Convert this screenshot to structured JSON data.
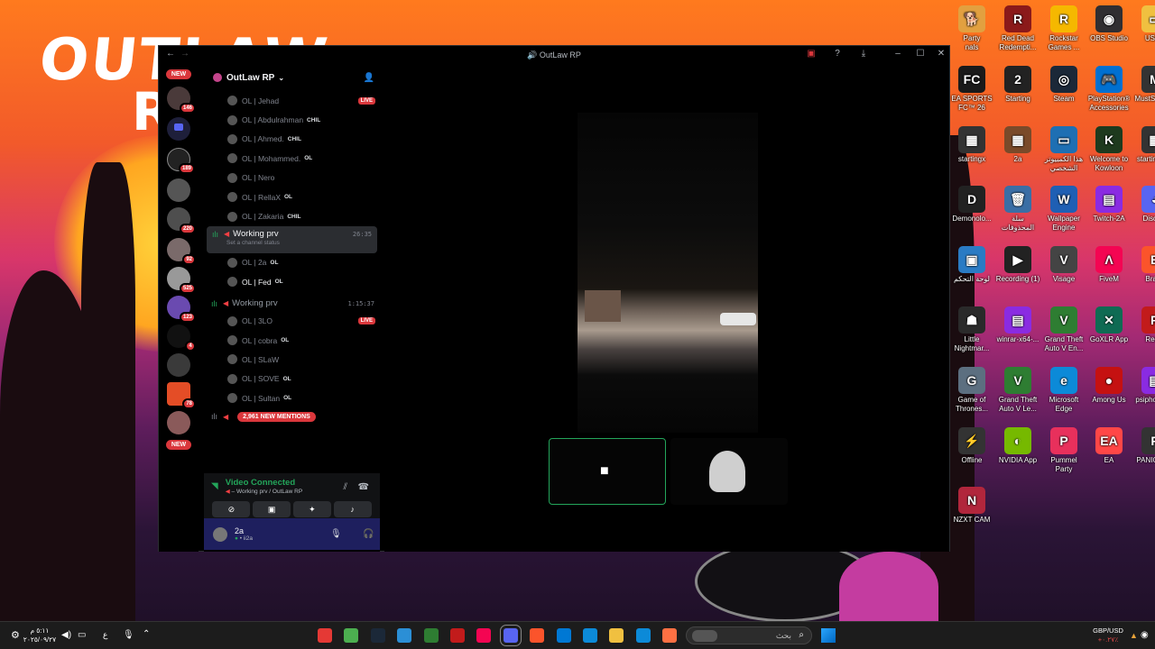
{
  "window": {
    "title": "OutLaw RP"
  },
  "servers": {
    "new_top": "NEW",
    "new_bottom": "NEW",
    "badges": [
      "146",
      "189",
      "220",
      "92",
      "525",
      "123",
      "4",
      "78"
    ]
  },
  "guild": {
    "name": "OutLaw RP"
  },
  "members_top": [
    {
      "name": "OL | Jehad",
      "tag": "",
      "live": "LIVE"
    },
    {
      "name": "OL | Abdulrahman",
      "tag": "CHIL",
      "live": ""
    },
    {
      "name": "OL | Ahmed.",
      "tag": "CHIL",
      "live": ""
    },
    {
      "name": "OL | Mohammed.",
      "tag": "OL",
      "live": ""
    },
    {
      "name": "OL | Nero",
      "tag": "",
      "live": ""
    },
    {
      "name": "OL | RellaX",
      "tag": "OL",
      "live": ""
    },
    {
      "name": "OL | Zakaria",
      "tag": "CHIL",
      "live": ""
    }
  ],
  "channel_active": {
    "name": "Working prv",
    "time": "26:35",
    "status_placeholder": "Set a channel status",
    "members": [
      {
        "name": "OL | 2a",
        "tag": "OL"
      },
      {
        "name": "OL | Fed",
        "tag": "OL"
      }
    ]
  },
  "channel_second": {
    "name": "Working prv",
    "time": "1:15:37",
    "members": [
      {
        "name": "OL | 3LO",
        "tag": "",
        "live": "LIVE"
      },
      {
        "name": "OL | cobra",
        "tag": "OL",
        "live": ""
      },
      {
        "name": "OL | SLaW",
        "tag": "",
        "live": ""
      },
      {
        "name": "OL | SOVE",
        "tag": "OL",
        "live": ""
      },
      {
        "name": "OL | Sultan",
        "tag": "OL",
        "live": ""
      }
    ]
  },
  "mentions_pill": "2,961 NEW MENTIONS",
  "voice": {
    "status": "Video Connected",
    "location": "Working prv / OutLaw RP"
  },
  "user": {
    "name": "2a",
    "sub": "ii2a"
  },
  "desktop_icons": [
    {
      "label": "Party\nnals",
      "color": "#e2a040",
      "glyph": "🐕"
    },
    {
      "label": "Red Dead\nRedempti...",
      "color": "#8b1a1a",
      "glyph": "R"
    },
    {
      "label": "Rockstar\nGames ...",
      "color": "#f5b800",
      "glyph": "R"
    },
    {
      "label": "OBS Studio",
      "color": "#302e31",
      "glyph": "◉"
    },
    {
      "label": "USER",
      "color": "#f0c040",
      "glyph": "▭"
    },
    {
      "label": "EA SPORTS\nFC™ 26",
      "color": "#1a1a1a",
      "glyph": "FC"
    },
    {
      "label": "Starting",
      "color": "#222",
      "glyph": "2"
    },
    {
      "label": "Steam",
      "color": "#1b2838",
      "glyph": "◎"
    },
    {
      "label": "PlayStation®\nAccessories",
      "color": "#0070d1",
      "glyph": "🎮"
    },
    {
      "label": "MustScream",
      "color": "#333",
      "glyph": "M"
    },
    {
      "label": "startingx",
      "color": "#333",
      "glyph": "▦"
    },
    {
      "label": "2a",
      "color": "#7a4a2a",
      "glyph": "▦"
    },
    {
      "label": "هذا الكمبيوتر\nالشخصي",
      "color": "#1e6fb3",
      "glyph": "▭"
    },
    {
      "label": "Welcome to\nKowloon",
      "color": "#1e3a1e",
      "glyph": "K"
    },
    {
      "label": "startingxس",
      "color": "#333",
      "glyph": "▦"
    },
    {
      "label": "Demonolo...",
      "color": "#222",
      "glyph": "D"
    },
    {
      "label": "سلة\nالمحذوفات",
      "color": "#3a6ea5",
      "glyph": "🗑"
    },
    {
      "label": "Wallpaper\nEngine",
      "color": "#1f5fb4",
      "glyph": "W"
    },
    {
      "label": "Twitch-2A",
      "color": "#8a2be2",
      "glyph": "▤"
    },
    {
      "label": "Discord",
      "color": "#5865f2",
      "glyph": "◕"
    },
    {
      "label": "لوحة التحكم",
      "color": "#2a7bc4",
      "glyph": "▣"
    },
    {
      "label": "Recording (1)",
      "color": "#222",
      "glyph": "▶"
    },
    {
      "label": "Visage",
      "color": "#444",
      "glyph": "V"
    },
    {
      "label": "FiveM",
      "color": "#f40552",
      "glyph": "Λ"
    },
    {
      "label": "Brave",
      "color": "#fb542b",
      "glyph": "B"
    },
    {
      "label": "Little\nNightmar...",
      "color": "#2a2a2a",
      "glyph": "☗"
    },
    {
      "label": "winrar-x64-...",
      "color": "#8a2be2",
      "glyph": "▤"
    },
    {
      "label": "Grand Theft\nAuto V En...",
      "color": "#2e7d32",
      "glyph": "V"
    },
    {
      "label": "GoXLR App",
      "color": "#0f6b53",
      "glyph": "✕"
    },
    {
      "label": "RedM",
      "color": "#c21b1b",
      "glyph": "R"
    },
    {
      "label": "Game of\nThrones...",
      "color": "#5c6f80",
      "glyph": "G"
    },
    {
      "label": "Grand Theft\nAuto V Le...",
      "color": "#2e7d32",
      "glyph": "V"
    },
    {
      "label": "Microsoft\nEdge",
      "color": "#0c8ad8",
      "glyph": "e"
    },
    {
      "label": "Among Us",
      "color": "#c51111",
      "glyph": "●"
    },
    {
      "label": "psiphon.v12",
      "color": "#8a2be2",
      "glyph": "▤"
    },
    {
      "label": "Offline",
      "color": "#333",
      "glyph": "⚡"
    },
    {
      "label": "NVIDIA App",
      "color": "#76b900",
      "glyph": "◐"
    },
    {
      "label": "Pummel\nParty",
      "color": "#e8305c",
      "glyph": "P"
    },
    {
      "label": "EA",
      "color": "#ff4747",
      "glyph": "EA"
    },
    {
      "label": "PANICORE",
      "color": "#333",
      "glyph": "P"
    },
    {
      "label": "NZXT CAM",
      "color": "#b1263c",
      "glyph": "N"
    }
  ],
  "taskbar": {
    "search_placeholder": "بحث",
    "tray_lang": "ع",
    "clock_time": "٥:١١ م",
    "clock_date": "٢٠٢٥/٠٩/٢٧",
    "currency": "GBP/USD",
    "currency_change": "+٠.٢٧٪"
  }
}
